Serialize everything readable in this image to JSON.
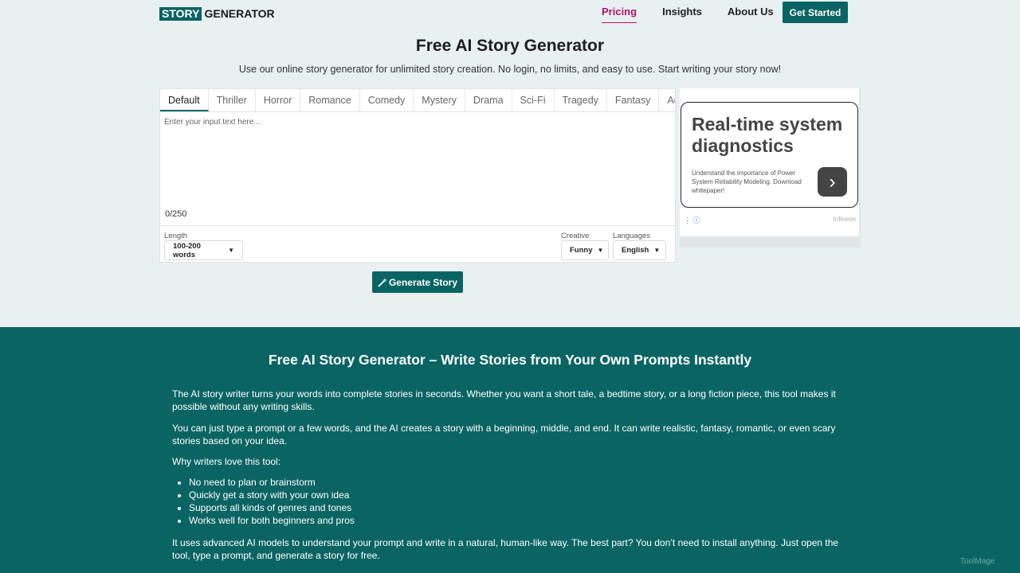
{
  "header": {
    "logo_box": "STORY",
    "logo_text": "GENERATOR",
    "nav": [
      "Pricing",
      "Insights",
      "About Us"
    ],
    "cta": "Get Started"
  },
  "hero": {
    "title": "Free AI Story Generator",
    "subtitle": "Use our online story generator for unlimited story creation. No login, no limits, and easy to use. Start writing your story now!"
  },
  "editor": {
    "tabs": [
      "Default",
      "Thriller",
      "Horror",
      "Romance",
      "Comedy",
      "Mystery",
      "Drama",
      "Sci-Fi",
      "Tragedy",
      "Fantasy",
      "Adventu"
    ],
    "placeholder": "Enter your input text here...",
    "counter": "0/250",
    "length_label": "Length",
    "length_value": "100-200 words",
    "creative_label": "Creative",
    "creative_value": "Funny",
    "languages_label": "Languages",
    "languages_value": "English",
    "generate": "Generate Story"
  },
  "ad": {
    "headline": "Real-time system diagnostics",
    "body": "Understand the importance of Power System Reliability Modeling. Download whitepaper!",
    "brand": "Infineon"
  },
  "content": {
    "heading": "Free AI Story Generator – Write Stories from Your Own Prompts Instantly",
    "p1": "The AI story writer turns your words into complete stories in seconds. Whether you want a short tale, a bedtime story, or a long fiction piece, this tool makes it possible without any writing skills.",
    "p2": "You can just type a prompt or a few words, and the AI creates a story with a beginning, middle, and end. It can write realistic, fantasy, romantic, or even scary stories based on your idea.",
    "p3": "Why writers love this tool:",
    "list": [
      "No need to plan or brainstorm",
      "Quickly get a story with your own idea",
      "Supports all kinds of genres and tones",
      "Works well for both beginners and pros"
    ],
    "p4": "It uses advanced AI models to understand your prompt and write in a natural, human-like way. The best part? You don’t need to install anything. Just open the tool, type a prompt, and generate a story for free."
  },
  "watermark": "ToolMage",
  "colors": {
    "brand": "#0b6464",
    "accent": "#b01563"
  }
}
